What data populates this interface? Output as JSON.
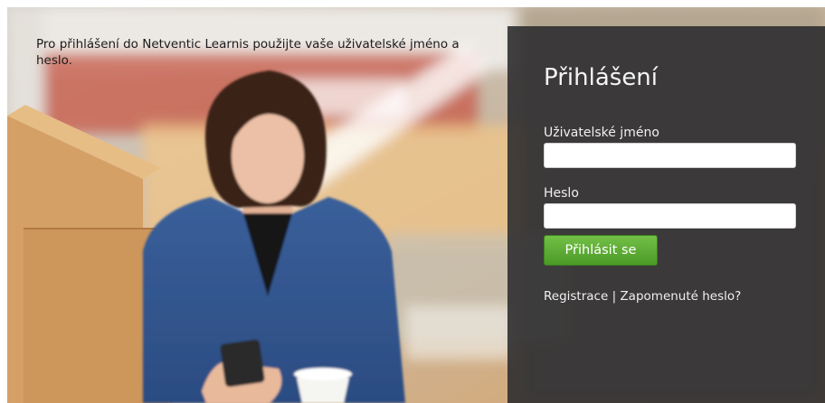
{
  "intro_text": "Pro přihlášení do Netventic Learnis použijte vaše uživatelské jméno a heslo.",
  "login": {
    "title": "Přihlášení",
    "username_label": "Uživatelské jméno",
    "username_value": "",
    "password_label": "Heslo",
    "password_value": "",
    "submit_label": "Přihlásit se",
    "register_link": "Registrace",
    "separator": "|",
    "forgot_link": "Zapomenuté heslo?"
  },
  "colors": {
    "panel_bg": "#2a2a2c",
    "button_green": "#5dab35",
    "panel_text": "#f0f0f0"
  }
}
